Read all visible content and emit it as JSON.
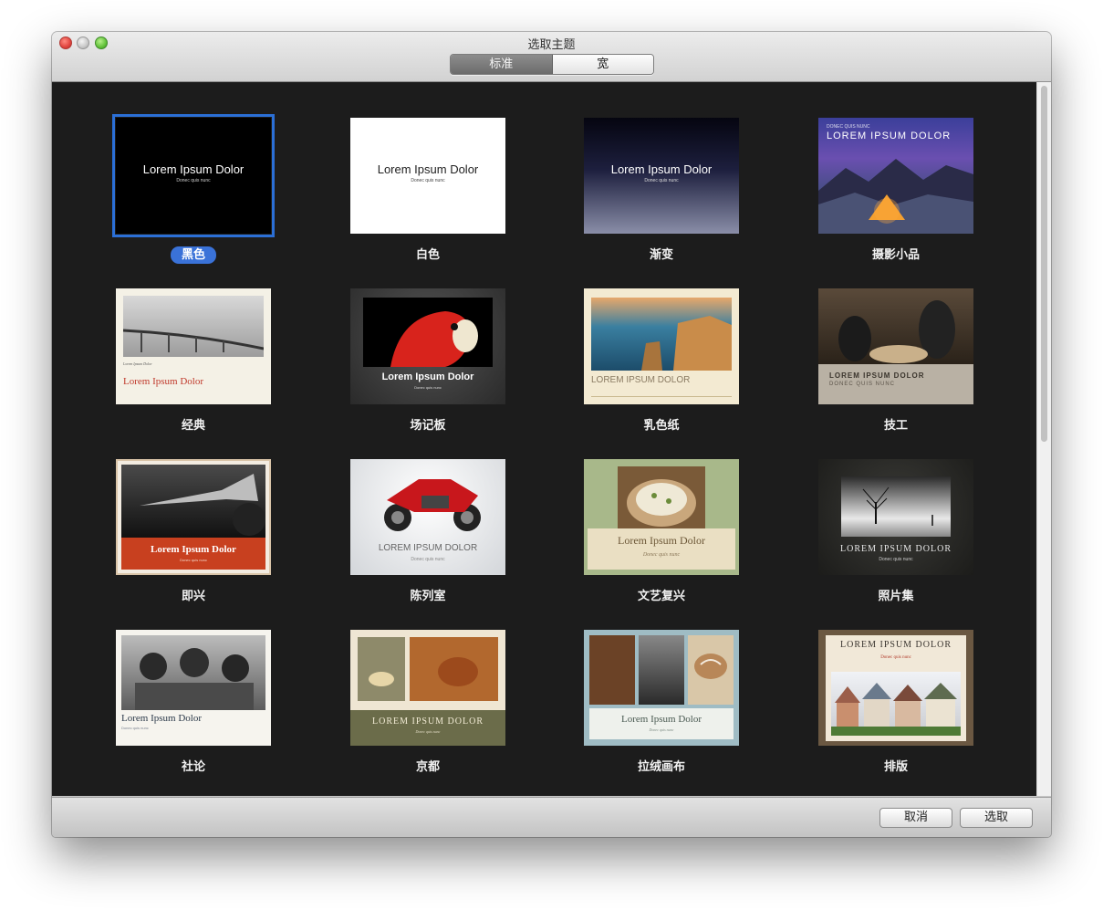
{
  "window": {
    "title": "选取主题"
  },
  "tabs": [
    {
      "label": "标准",
      "active": true
    },
    {
      "label": "宽",
      "active": false
    }
  ],
  "sample": {
    "title": "Lorem Ipsum Dolor",
    "title_caps": "LOREM IPSUM DOLOR",
    "subtitle": "Donec quis nunc",
    "subtitle_caps": "DONEC QUIS NUNC"
  },
  "themes": [
    {
      "name": "黑色",
      "selected": true
    },
    {
      "name": "白色"
    },
    {
      "name": "渐变"
    },
    {
      "name": "摄影小品"
    },
    {
      "name": "经典"
    },
    {
      "name": "场记板"
    },
    {
      "name": "乳色纸"
    },
    {
      "name": "技工"
    },
    {
      "name": "即兴"
    },
    {
      "name": "陈列室"
    },
    {
      "name": "文艺复兴"
    },
    {
      "name": "照片集"
    },
    {
      "name": "社论"
    },
    {
      "name": "京都"
    },
    {
      "name": "拉绒画布"
    },
    {
      "name": "排版"
    }
  ],
  "buttons": {
    "cancel": "取消",
    "choose": "选取"
  },
  "colors": {
    "selection": "#3a72d8",
    "background": "#1c1c1c"
  }
}
